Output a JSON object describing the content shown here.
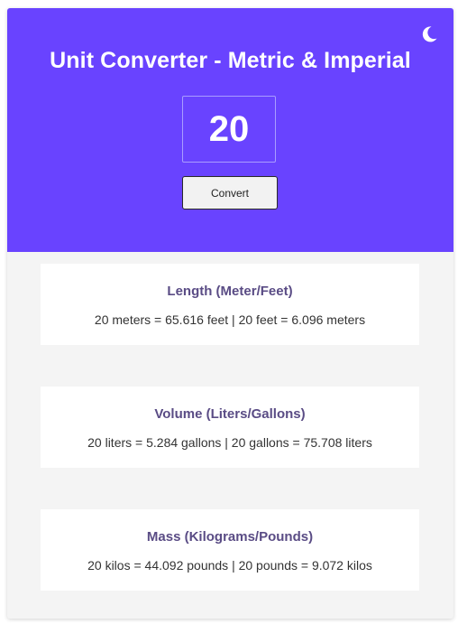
{
  "header": {
    "title": "Unit Converter - Metric & Imperial",
    "input_value": "20",
    "convert_label": "Convert",
    "theme_icon": "moon-icon",
    "background_color": "#6943ff"
  },
  "cards": [
    {
      "title": "Length (Meter/Feet)",
      "result": "20 meters = 65.616 feet | 20 feet = 6.096 meters"
    },
    {
      "title": "Volume (Liters/Gallons)",
      "result": "20 liters = 5.284 gallons | 20 gallons = 75.708 liters"
    },
    {
      "title": "Mass (Kilograms/Pounds)",
      "result": "20 kilos = 44.092 pounds | 20 pounds = 9.072 kilos"
    }
  ]
}
